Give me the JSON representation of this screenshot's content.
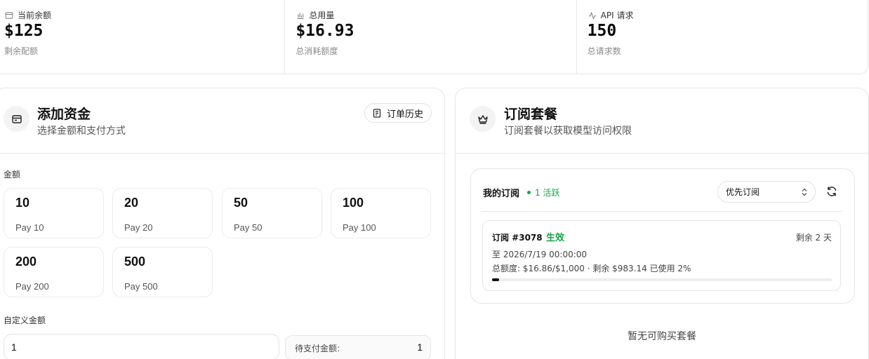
{
  "stats": [
    {
      "icon": "wallet-icon",
      "label": "当前余额",
      "value": "$125",
      "sub": "剩余配额"
    },
    {
      "icon": "bar-chart-icon",
      "label": "总用量",
      "value": "$16.93",
      "sub": "总消耗额度"
    },
    {
      "icon": "activity-icon",
      "label": "API 请求",
      "value": "150",
      "sub": "总请求数"
    }
  ],
  "add_funds": {
    "icon": "wallet-icon",
    "title": "添加资金",
    "subtitle": "选择金额和支付方式",
    "history_button": "订单历史",
    "amount_label": "金额",
    "amounts": [
      {
        "value": "10",
        "pay": "Pay 10"
      },
      {
        "value": "20",
        "pay": "Pay 20"
      },
      {
        "value": "50",
        "pay": "Pay 50"
      },
      {
        "value": "100",
        "pay": "Pay 100"
      },
      {
        "value": "200",
        "pay": "Pay 200"
      },
      {
        "value": "500",
        "pay": "Pay 500"
      }
    ],
    "custom_label": "自定义金额",
    "custom_value": "1",
    "pending_label": "待支付金额:",
    "pending_value": "1"
  },
  "subscription": {
    "icon": "crown-icon",
    "title": "订阅套餐",
    "subtitle": "订阅套餐以获取模型访问权限",
    "my_title": "我的订阅",
    "active_badge": "1 活跃",
    "priority_select": "优先订阅",
    "item": {
      "id": "订阅 #3078",
      "status": "生效",
      "remaining": "剩余 2 天",
      "until": "至 2026/7/19 00:00:00",
      "quota": "总额度: $16.86/$1,000 · 剩余 $983.14  已使用 2%",
      "used_fraction": 0.02
    },
    "empty_text": "暂无可购买套餐"
  },
  "colors": {
    "accent_green": "#16a34a",
    "border": "#e5e5e5",
    "muted_text": "#8a8a8a"
  }
}
